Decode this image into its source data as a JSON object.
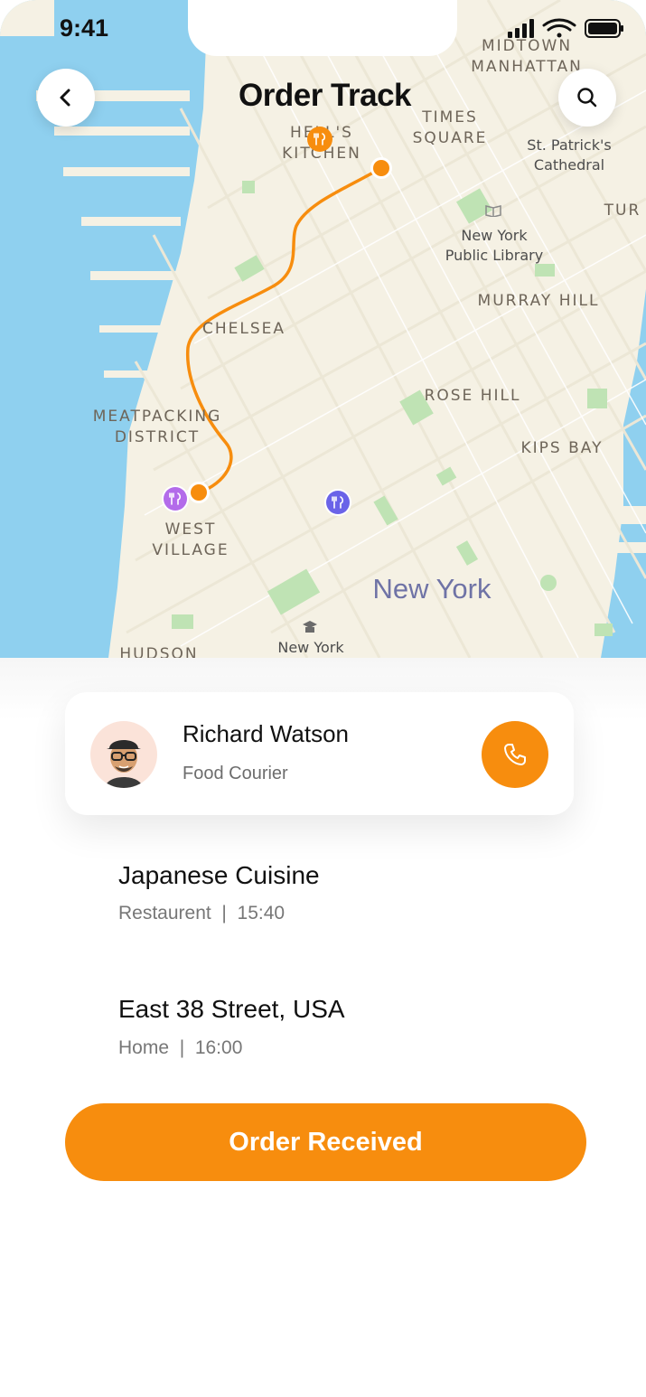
{
  "status_bar": {
    "time": "9:41"
  },
  "header": {
    "title": "Order Track",
    "back_icon": "chevron-left-icon",
    "search_icon": "search-icon"
  },
  "map": {
    "labels": {
      "midtown": "MIDTOWN\nMANHATTAN",
      "times_square": "TIMES\nSQUARE",
      "hells_kitchen": "HELL'S\nKITCHEN",
      "st_patricks": "St. Patrick's\nCathedral",
      "tur": "TUR",
      "ny_library": "New York\nPublic Library",
      "murray_hill": "MURRAY HILL",
      "chelsea": "CHELSEA",
      "rose_hill": "ROSE HILL",
      "meatpacking": "MEATPACKING\nDISTRICT",
      "kips_bay": "KIPS BAY",
      "west_village": "WEST\nVILLAGE",
      "new_york": "New York",
      "new_york_small": "New York",
      "hudson": "HUDSON"
    },
    "route_color": "#F78D0E",
    "pin_colors": {
      "origin": "#F78D0E",
      "restaurant_west": "#B36BEA",
      "restaurant_east": "#6A63E8"
    }
  },
  "courier": {
    "name": "Richard Watson",
    "role": "Food Courier",
    "call_icon": "phone-icon"
  },
  "stops": [
    {
      "title": "Japanese Cuisine",
      "place": "Restaurent",
      "time": "15:40"
    },
    {
      "title": "East 38 Street, USA",
      "place": "Home",
      "time": "16:00"
    }
  ],
  "action": {
    "label": "Order Received"
  },
  "colors": {
    "accent": "#F78D0E",
    "avatar_bg": "#FBE3D9"
  }
}
